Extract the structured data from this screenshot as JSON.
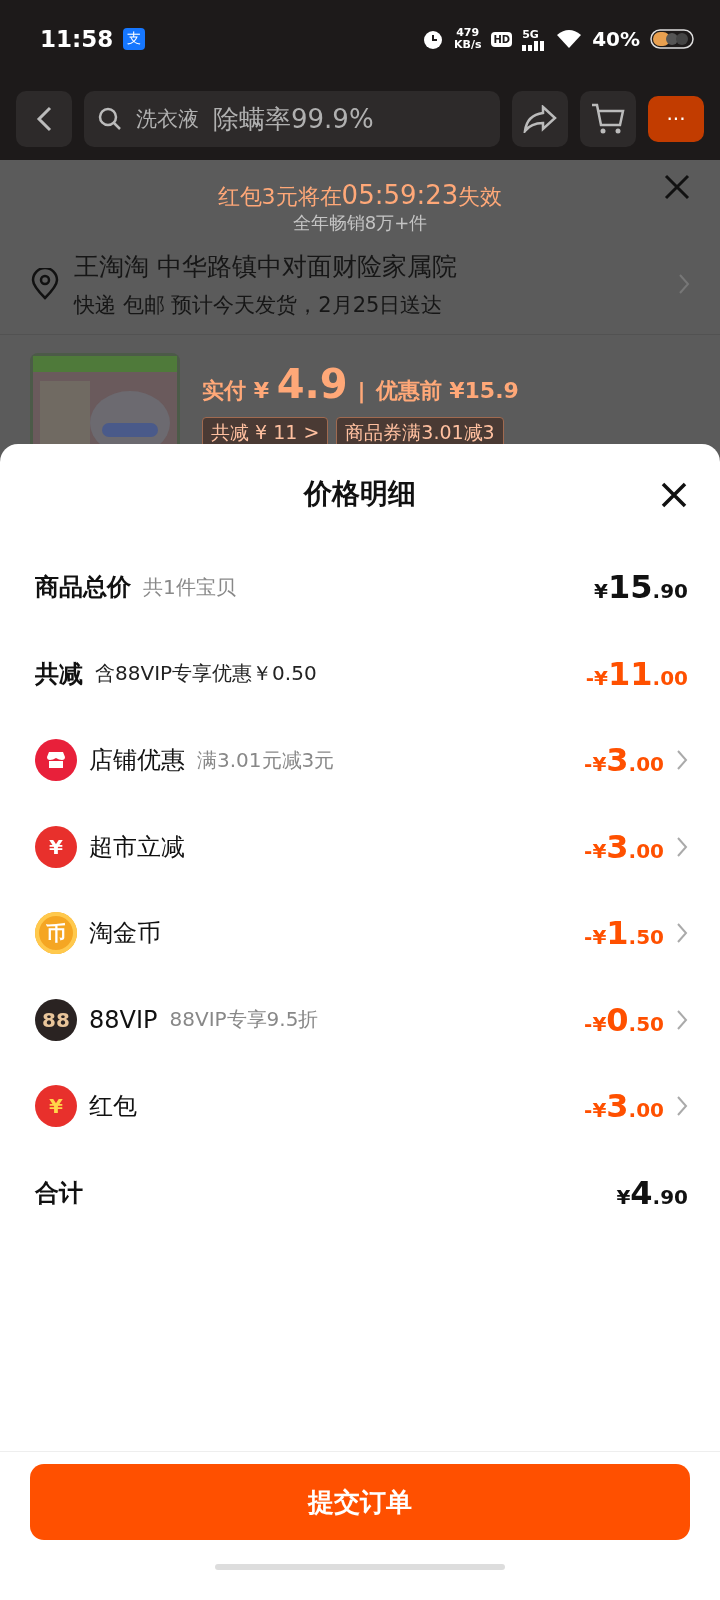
{
  "status_bar": {
    "time": "11:58",
    "app_badge": "支",
    "speed_value": "479",
    "speed_unit": "KB/s",
    "hd": "HD",
    "network": "5G",
    "battery": "40%"
  },
  "nav": {
    "search_keyword": "洗衣液",
    "search_slogan": "除螨率99.9%",
    "more": "···"
  },
  "order": {
    "coupon_notice": "红包3元将在",
    "countdown": "05:59:23",
    "coupon_suffix": "失效",
    "sales_note": "全年畅销8万+件",
    "address": {
      "name": "王淘淘",
      "detail": "中华路镇中对面财险家属院",
      "delivery": "快递 包邮 预计今天发货，2月25日送达"
    },
    "product": {
      "paid_label": "实付",
      "paid_currency": "¥",
      "paid_value": "4.9",
      "separator": "|",
      "before_label": "优惠前 ¥15.9",
      "tags": [
        "共减 ¥ 11 >",
        "商品券满3.01减3"
      ]
    }
  },
  "sheet": {
    "title": "价格明细",
    "rows": [
      {
        "kind": "total",
        "label": "商品总价",
        "note": "共1件宝贝",
        "prefix": "¥",
        "integer": "15",
        "decimal": ".90"
      },
      {
        "kind": "reduction",
        "label": "共减",
        "note": "含88VIP专享优惠￥0.50",
        "prefix": "-¥",
        "integer": "11",
        "decimal": ".00"
      },
      {
        "kind": "store",
        "label": "店铺优惠",
        "note": "满3.01元减3元",
        "prefix": "-¥",
        "integer": "3",
        "decimal": ".00"
      },
      {
        "kind": "supermarket",
        "icon_text": "¥",
        "label": "超市立减",
        "prefix": "-¥",
        "integer": "3",
        "decimal": ".00"
      },
      {
        "kind": "coin",
        "icon_text": "币",
        "label": "淘金币",
        "prefix": "-¥",
        "integer": "1",
        "decimal": ".50"
      },
      {
        "kind": "vip",
        "icon_text": "88",
        "label": "88VIP",
        "note": "88VIP专享9.5折",
        "prefix": "-¥",
        "integer": "0",
        "decimal": ".50"
      },
      {
        "kind": "redpacket",
        "icon_text": "¥",
        "label": "红包",
        "prefix": "-¥",
        "integer": "3",
        "decimal": ".00"
      },
      {
        "kind": "sum",
        "label": "合计",
        "prefix": "¥",
        "integer": "4",
        "decimal": ".90"
      }
    ],
    "submit": "提交订单"
  }
}
